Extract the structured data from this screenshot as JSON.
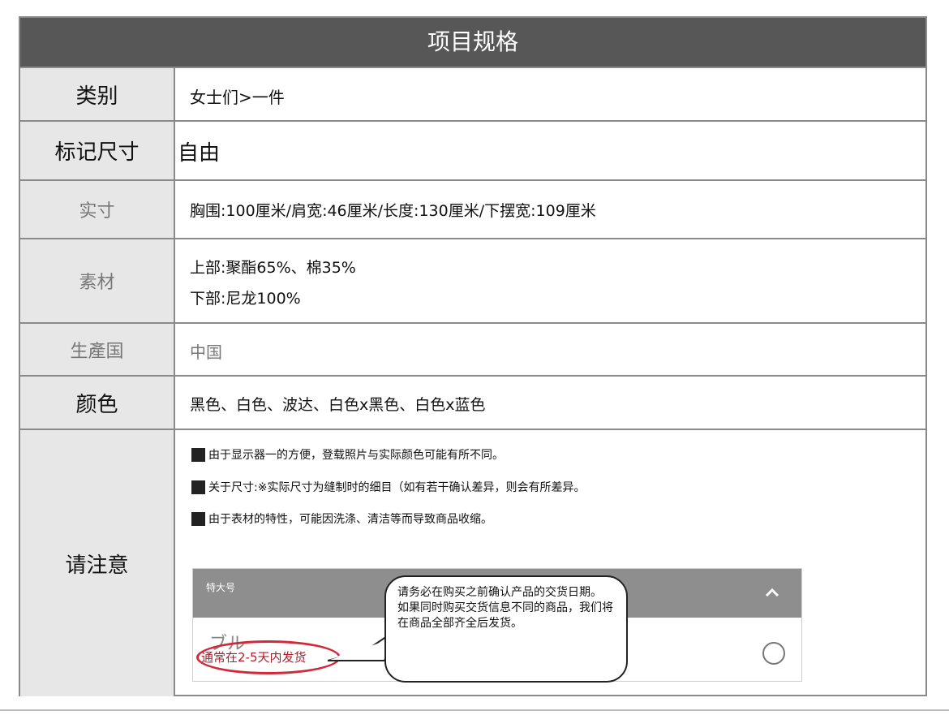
{
  "header": {
    "title": "项目规格"
  },
  "rows": {
    "category": {
      "label": "类别",
      "value": "女士们>一件"
    },
    "size": {
      "label": "标记尺寸",
      "value": "自由"
    },
    "measure": {
      "label": "实寸",
      "value": "胸围:100厘米/肩宽:46厘米/长度:130厘米/下摆宽:109厘米"
    },
    "material": {
      "label": "素材",
      "value_line1": "上部:聚酯65%、棉35%",
      "value_line2": "下部:尼龙100%"
    },
    "origin": {
      "label": "生產国",
      "value": "中国"
    },
    "color": {
      "label": "颜色",
      "value": "黑色、白色、波达、白色x黑色、白色x蓝色"
    },
    "notice": {
      "label": "请注意",
      "notes": [
        "由于显示器一的方便，登载照片与实际颜色可能有所不同。",
        "关于尺寸:※实际尺寸为缝制时的细目（如有若干确认差异，则会有所差异。",
        "由于表材的特性，可能因洗涤、清洁等而导致商品收缩。"
      ]
    }
  },
  "shop_widget": {
    "option_name": "特大号",
    "item_text": "ブル",
    "delivery_text": "通常在2-5天内发货",
    "chevron_icon": "chevron-up-icon",
    "radio_icon": "radio-unselected-icon"
  },
  "callout": {
    "line1": "请务必在购买之前确认产品的交货日期。",
    "line2": "如果同时购买交货信息不同的商品，我们将在商品全部齐全后发货。"
  },
  "colors": {
    "header_bg": "#575757",
    "label_bg": "#e7e7e7",
    "highlight_red": "#d1283a"
  }
}
